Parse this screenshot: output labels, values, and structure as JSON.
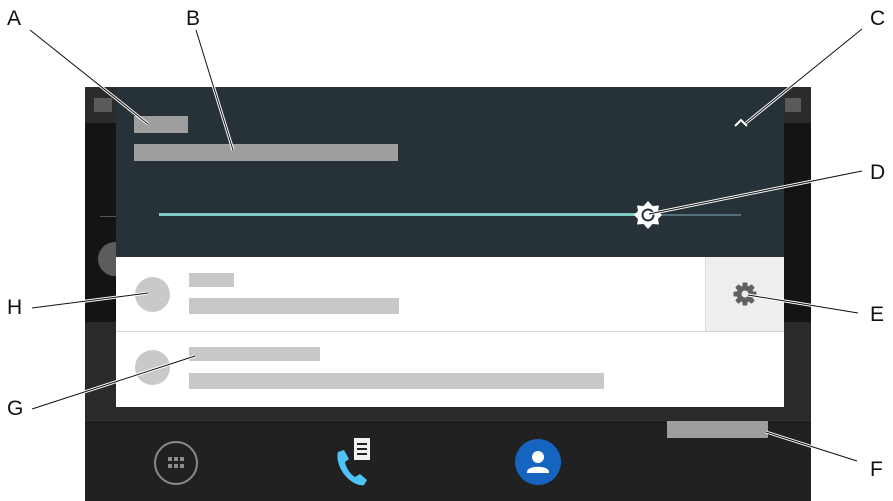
{
  "callouts": {
    "a": "A",
    "b": "B",
    "c": "C",
    "d": "D",
    "e": "E",
    "f": "F",
    "g": "G",
    "h": "H"
  },
  "colors": {
    "shade_panel": "#263238",
    "slider_track_active": "#80cbc4",
    "slider_track_inactive": "#546e7a",
    "dock": "#212121",
    "contacts_button": "#1565c0",
    "phone_icon": "#4fc3f7",
    "placeholder": "#b3b3b3"
  },
  "brightness_level": 0.84,
  "icons": {
    "collapse": "chevron-up-icon",
    "brightness": "brightness-icon",
    "settings": "gear-icon",
    "apps": "app-drawer-icon",
    "phone": "phone-icon",
    "contacts": "person-icon"
  }
}
